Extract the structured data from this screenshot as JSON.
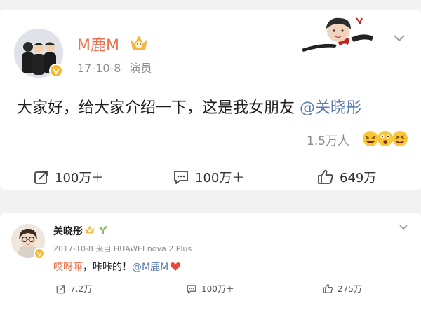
{
  "post": {
    "username": "M鹿M",
    "date": "17-10-8",
    "role": "演员",
    "text_main": "大家好，给大家介绍一下，这是我女朋友",
    "mention": "@关晓彤",
    "like_summary": "1.5万人",
    "actions": {
      "repost_count": "100万＋",
      "comment_count": "100万＋",
      "like_count": "649万"
    },
    "promo_image": "recording-banner-portrait"
  },
  "reply": {
    "username": "关晓彤",
    "date": "2017-10-8",
    "source": "来自 HUAWEI nova 2 Plus",
    "text_highlight": "哎呀嘛",
    "text_body": "，咔咔的！",
    "mention": "@M鹿M",
    "actions": {
      "repost_count": "7.2万",
      "comment_count": "100万＋",
      "like_count": "275万"
    }
  },
  "colors": {
    "username": "#eb7350",
    "mention": "#5b7cae",
    "badge": "#f9b72a",
    "heart": "#e8473c"
  }
}
